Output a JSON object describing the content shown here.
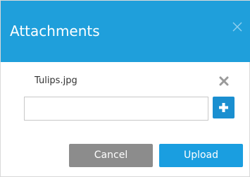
{
  "dialog": {
    "title": "Attachments",
    "header_color": "#1f9fdb",
    "close_icon": "close-icon"
  },
  "attachment": {
    "file_name": "Tulips.jpg",
    "remove_icon": "remove-icon"
  },
  "file_input": {
    "value": "",
    "placeholder": ""
  },
  "add_button": {
    "icon": "plus-icon",
    "color": "#1a8fd0"
  },
  "footer": {
    "cancel_label": "Cancel",
    "upload_label": "Upload",
    "cancel_color": "#8c8c8c",
    "upload_color": "#1a9ee0"
  }
}
